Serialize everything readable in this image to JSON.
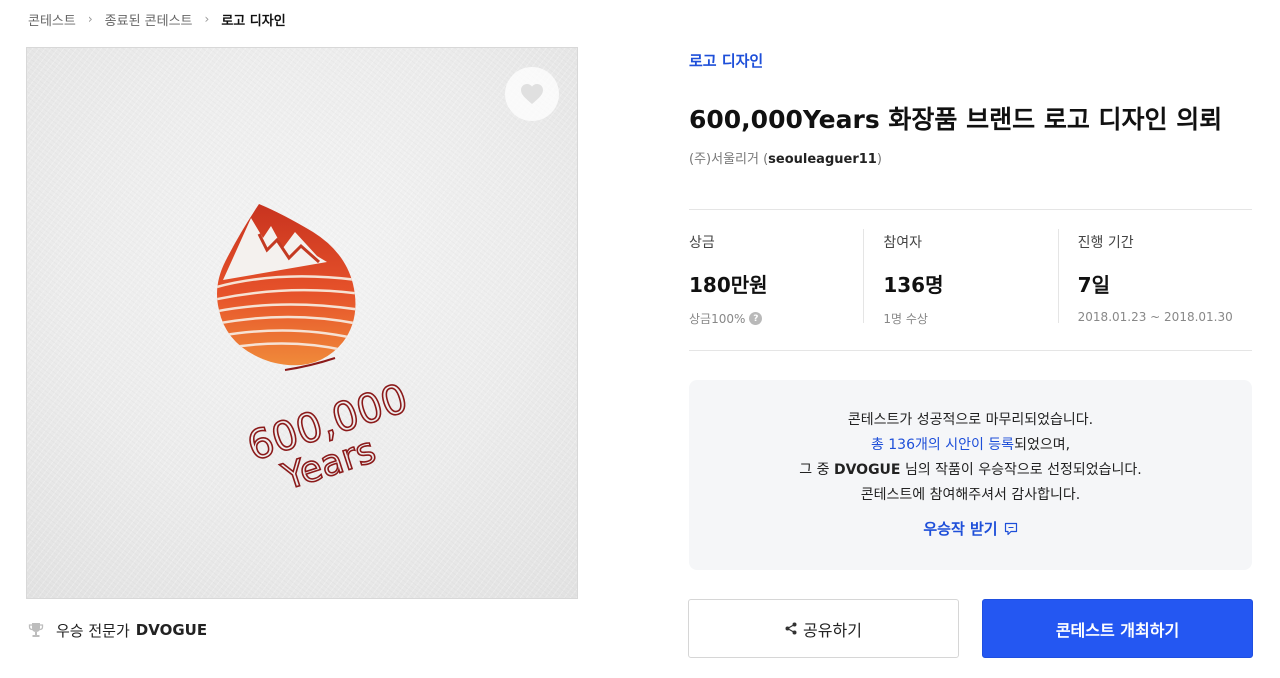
{
  "breadcrumb": {
    "items": [
      "콘테스트",
      "종료된 콘테스트",
      "로고 디자인"
    ]
  },
  "contest": {
    "category": "로고 디자인",
    "title": "600,000Years 화장품 브랜드 로고 디자인 의뢰",
    "host_name": "(주)서울리거",
    "host_id": "seouleaguer11"
  },
  "artwork": {
    "logo_line1": "600,000",
    "logo_line2": "Years",
    "like_icon": "heart-icon"
  },
  "stats": {
    "prize": {
      "label": "상금",
      "value": "180만원",
      "sub": "상금100%"
    },
    "participants": {
      "label": "참여자",
      "value": "136명",
      "sub": "1명 수상"
    },
    "period": {
      "label": "진행 기간",
      "value": "7일",
      "sub": "2018.01.23 ~ 2018.01.30"
    }
  },
  "notice": {
    "line1": "콘테스트가 성공적으로 마무리되었습니다.",
    "line2_link": "총 136개의 시안이 등록",
    "line2_rest": "되었으며,",
    "line3_pre": "그 중",
    "line3_name": "DVOGUE",
    "line3_rest": "님의 작품이 우승작으로 선정되었습니다.",
    "line4": "콘테스트에 참여해주셔서 감사합니다.",
    "receive_label": "우승작 받기"
  },
  "winner": {
    "label": "우승 전문가",
    "name": "DVOGUE",
    "icon": "trophy-icon"
  },
  "actions": {
    "share_label": "공유하기",
    "host_label": "콘테스트 개최하기"
  },
  "colors": {
    "accent": "#2457f2",
    "link": "#1e4fd9",
    "logo_red": "#8b1a1a",
    "logo_orange": "#e8622a"
  }
}
